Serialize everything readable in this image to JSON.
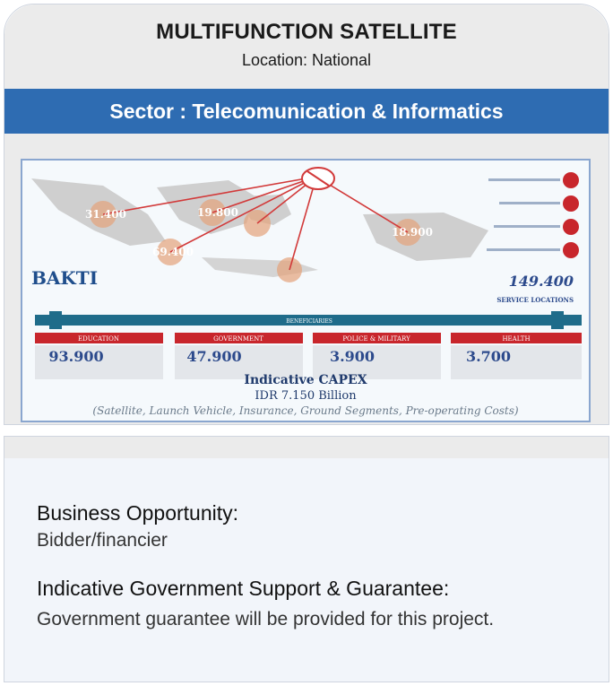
{
  "header": {
    "title": "MULTIFUNCTION SATELLITE",
    "location": "Location: National"
  },
  "sector": "Sector : Telecomunication & Informatics",
  "infographic": {
    "logo": "BAKTI",
    "total_value": "149.400",
    "total_label": "SERVICE LOCATIONS",
    "beneficiaries_label": "BENEFICIARIES",
    "categories": [
      {
        "name": "EDUCATION",
        "value": "93.900"
      },
      {
        "name": "GOVERNMENT",
        "value": "47.900"
      },
      {
        "name": "POLICE & MILITARY",
        "value": "3.900"
      },
      {
        "name": "HEALTH",
        "value": "3.700"
      }
    ],
    "capex_title": "Indicative CAPEX",
    "capex_value": "IDR 7.150 Billion",
    "capex_note": "(Satellite, Launch Vehicle, Insurance, Ground Segments, Pre-operating Costs)",
    "region_values": [
      "31.400",
      "19.800",
      "69.400",
      "18.900"
    ],
    "colors": {
      "red": "#c8262c",
      "teal": "#1f6c8a",
      "blue_text": "#2c4a8c"
    }
  },
  "opportunity": {
    "label": "Business Opportunity:",
    "value": "Bidder/financier"
  },
  "government_support": {
    "label": "Indicative Government Support & Guarantee:",
    "value": "Government guarantee will be provided for this project."
  }
}
